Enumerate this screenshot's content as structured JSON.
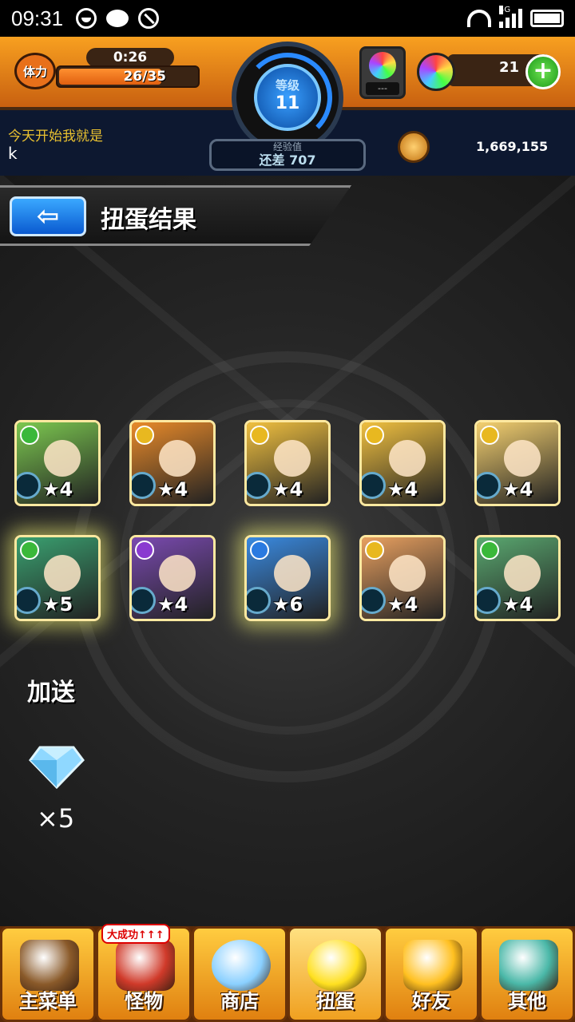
{
  "status_bar": {
    "time": "09:31",
    "network": "4G"
  },
  "header": {
    "stamina": {
      "label": "体力",
      "timer": "0:26",
      "value": "26/35",
      "fraction": 0.743
    },
    "level": {
      "label": "等级",
      "value": "11"
    },
    "exp": {
      "label": "经验值",
      "value": "还差 707"
    },
    "item_slot": {
      "value": "---"
    },
    "orbs": {
      "count": "21"
    },
    "message": {
      "text": "今天开始我就是",
      "name": "k"
    },
    "coins": {
      "value": "1,669,155"
    }
  },
  "page": {
    "title": "扭蛋结果"
  },
  "results": [
    {
      "stars": "★4",
      "element": "wood",
      "elem_color": "#3ab83a",
      "bg": "#7cc850",
      "glow": false
    },
    {
      "stars": "★4",
      "element": "light",
      "elem_color": "#e8b820",
      "bg": "#e88a2a",
      "glow": false
    },
    {
      "stars": "★4",
      "element": "light",
      "elem_color": "#e8b820",
      "bg": "#f0c040",
      "glow": false
    },
    {
      "stars": "★4",
      "element": "light",
      "elem_color": "#e8b820",
      "bg": "#f0c040",
      "glow": false
    },
    {
      "stars": "★4",
      "element": "light",
      "elem_color": "#e8b820",
      "bg": "#f4d070",
      "glow": false
    },
    {
      "stars": "★5",
      "element": "wood",
      "elem_color": "#3ab83a",
      "bg": "#3aa070",
      "glow": true
    },
    {
      "stars": "★4",
      "element": "dark",
      "elem_color": "#8a3ad0",
      "bg": "#7a4ab0",
      "glow": false
    },
    {
      "stars": "★6",
      "element": "water",
      "elem_color": "#2a7ae0",
      "bg": "#3a8ae0",
      "glow": true
    },
    {
      "stars": "★4",
      "element": "light",
      "elem_color": "#e8b820",
      "bg": "#e8a060",
      "glow": false
    },
    {
      "stars": "★4",
      "element": "wood",
      "elem_color": "#3ab83a",
      "bg": "#5aa870",
      "glow": false
    }
  ],
  "bonus": {
    "label": "加送",
    "count": "×5",
    "icon": "diamond-icon"
  },
  "nav": [
    {
      "label": "主菜单",
      "icon": "home-icon",
      "color": "#8a5a2a"
    },
    {
      "label": "怪物",
      "icon": "monster-icon",
      "color": "#d03a2a",
      "badge": "大成功↑↑↑"
    },
    {
      "label": "商店",
      "icon": "shop-orb-icon",
      "color": "#8ad0ff"
    },
    {
      "label": "扭蛋",
      "icon": "gacha-egg-icon",
      "color": "#ffe020"
    },
    {
      "label": "好友",
      "icon": "friends-icon",
      "color": "#ffc020"
    },
    {
      "label": "其他",
      "icon": "other-icon",
      "color": "#4ab8a8"
    }
  ]
}
